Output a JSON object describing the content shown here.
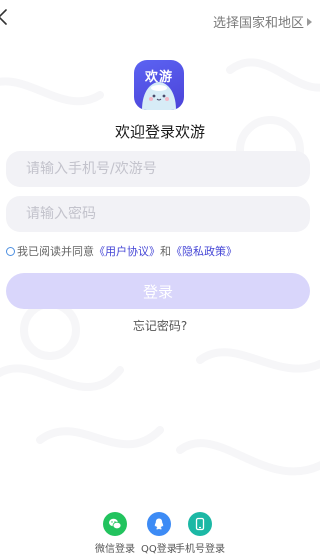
{
  "header": {
    "back_icon": "chevron-left-icon",
    "region_label": "选择国家和地区"
  },
  "app": {
    "logo_text": "欢游",
    "brand_color": "#4f4ee6",
    "welcome_title": "欢迎登录欢游"
  },
  "form": {
    "phone_placeholder": "请输入手机号/欢游号",
    "password_placeholder": "请输入密码",
    "agreement": {
      "prefix": "我已阅读并同意",
      "user_agreement": "《用户协议》",
      "conjunction": "和",
      "privacy_policy": "《隐私政策》",
      "link_color": "#4546d6"
    },
    "login_label": "登录",
    "login_button_color": "#d9d6fb",
    "forgot_password": "忘记密码?"
  },
  "social_login": {
    "wechat_label": "微信登录",
    "qq_label": "QQ登录",
    "phone_label": "手机号登录",
    "wechat_color": "#22c35e",
    "qq_color": "#3d8bf5",
    "phone_color": "#1cb8a5"
  }
}
